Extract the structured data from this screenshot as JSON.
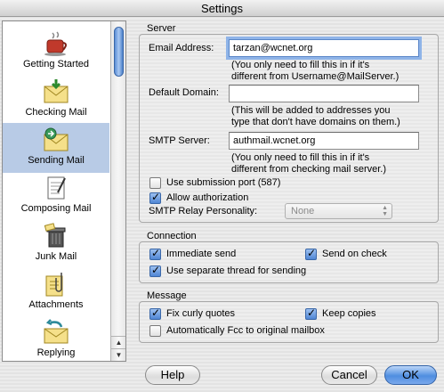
{
  "window": {
    "title": "Settings"
  },
  "sidebar": {
    "items": [
      {
        "label": "Getting Started",
        "icon": "coffee-cup-icon",
        "selected": false
      },
      {
        "label": "Checking Mail",
        "icon": "envelope-download-icon",
        "selected": false
      },
      {
        "label": "Sending Mail",
        "icon": "envelope-send-icon",
        "selected": true
      },
      {
        "label": "Composing Mail",
        "icon": "compose-document-icon",
        "selected": false
      },
      {
        "label": "Junk Mail",
        "icon": "trash-can-icon",
        "selected": false
      },
      {
        "label": "Attachments",
        "icon": "paperclip-document-icon",
        "selected": false
      },
      {
        "label": "Replying",
        "icon": "reply-envelope-icon",
        "selected": false
      }
    ]
  },
  "server": {
    "group_label": "Server",
    "email_label": "Email Address:",
    "email_value": "tarzan@wcnet.org",
    "email_hint_1": "(You only need to fill this in if it's",
    "email_hint_2": "different from Username@MailServer.)",
    "domain_label": "Default Domain:",
    "domain_value": "",
    "domain_hint_1": "(This will be added to addresses you",
    "domain_hint_2": "type that don't have domains on them.)",
    "smtp_label": "SMTP Server:",
    "smtp_value": "authmail.wcnet.org",
    "smtp_hint_1": "(You only need to fill this in if it's",
    "smtp_hint_2": "different from checking mail server.)",
    "submission_port_label": "Use submission port (587)",
    "submission_port_checked": false,
    "allow_auth_label": "Allow authorization",
    "allow_auth_checked": true,
    "relay_label": "SMTP Relay Personality:",
    "relay_value": "None"
  },
  "connection": {
    "group_label": "Connection",
    "immediate_send_label": "Immediate send",
    "immediate_send_checked": true,
    "send_on_check_label": "Send on check",
    "send_on_check_checked": true,
    "separate_thread_label": "Use separate thread for sending",
    "separate_thread_checked": true
  },
  "message": {
    "group_label": "Message",
    "curly_quotes_label": "Fix curly quotes",
    "curly_quotes_checked": true,
    "keep_copies_label": "Keep copies",
    "keep_copies_checked": true,
    "auto_fcc_label": "Automatically Fcc to original mailbox",
    "auto_fcc_checked": false
  },
  "buttons": {
    "help": "Help",
    "cancel": "Cancel",
    "ok": "OK"
  },
  "colors": {
    "selection": "#b8cbe6",
    "accent": "#4f8ee0",
    "focus_ring": "#8fb4e8"
  }
}
